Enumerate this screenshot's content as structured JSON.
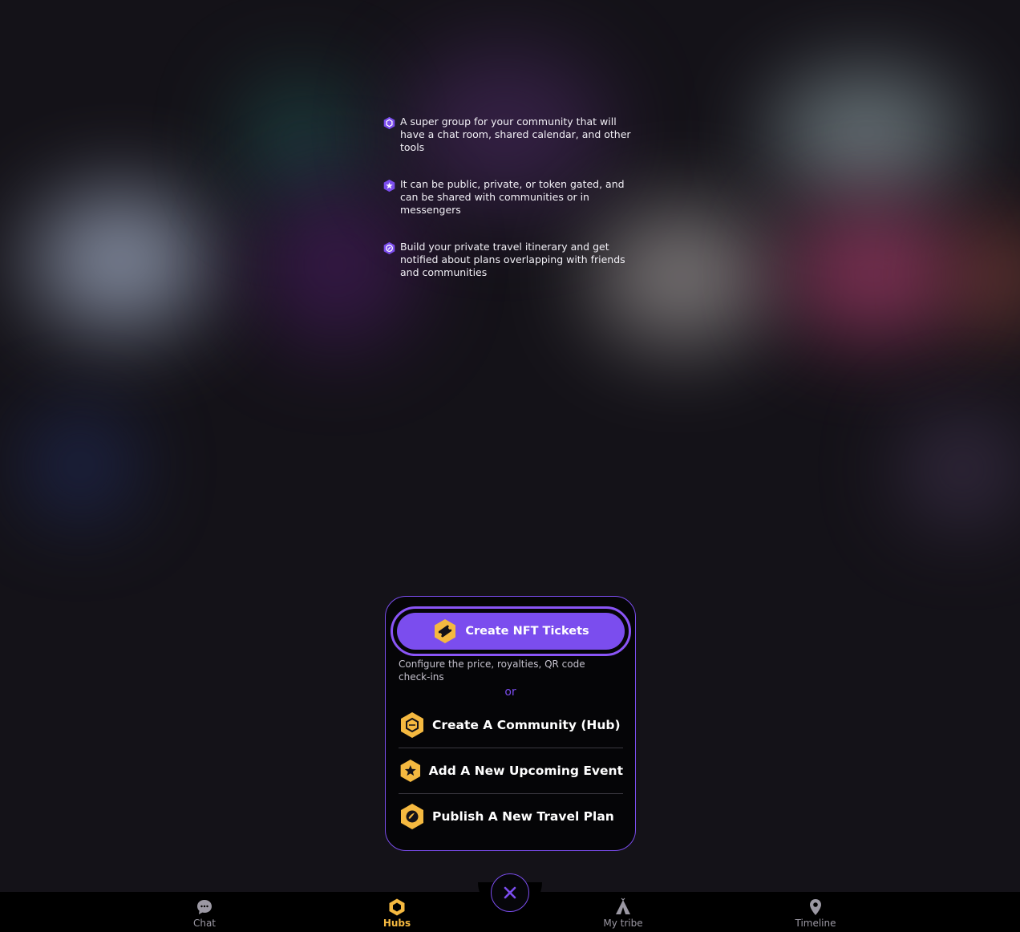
{
  "info": [
    {
      "icon": "hub-hexagon-icon",
      "text": "A super group for your community that will have a chat room, shared calendar, and other tools"
    },
    {
      "icon": "star-hexagon-icon",
      "text": "It can be public, private, or token gated, and can be shared with communities or in messengers"
    },
    {
      "icon": "travel-hexagon-icon",
      "text": "Build your private travel itinerary and get notified about plans overlapping with friends and communities"
    }
  ],
  "create_menu": {
    "nft_button": {
      "label": "Create NFT Tickets",
      "icon": "ticket-icon"
    },
    "nft_description": "Configure the price, royalties, QR code check-ins",
    "or_label": "or",
    "options": [
      {
        "label": "Create A Community (Hub)",
        "icon": "hub-icon"
      },
      {
        "label": "Add A New Upcoming Event",
        "icon": "star-icon"
      },
      {
        "label": "Publish A New Travel Plan",
        "icon": "globe-icon"
      }
    ]
  },
  "nav": {
    "items": [
      {
        "label": "Chat",
        "icon": "chat-icon",
        "active": false
      },
      {
        "label": "Hubs",
        "icon": "hubs-icon",
        "active": true
      },
      {
        "label": "My tribe",
        "icon": "tent-icon",
        "active": false
      },
      {
        "label": "Timeline",
        "icon": "location-pin-icon",
        "active": false
      }
    ],
    "close_icon": "close-icon"
  },
  "colors": {
    "accent": "#7b4dee",
    "gold": "#f5b940",
    "background": "#141218"
  }
}
